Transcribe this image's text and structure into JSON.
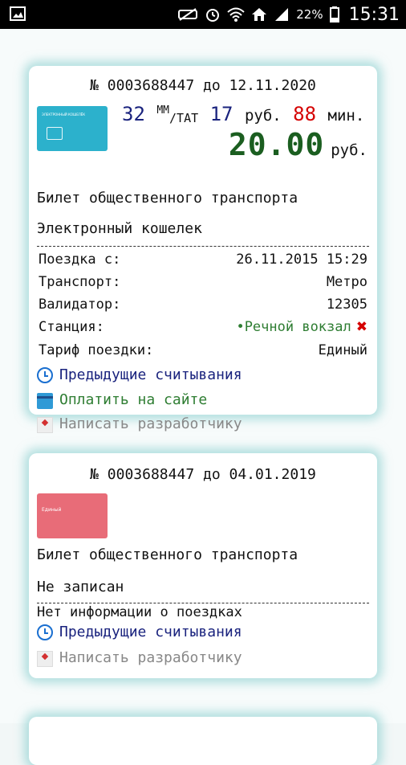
{
  "status_bar": {
    "battery_percent": "22%",
    "time": "15:31",
    "icons": [
      "gallery-icon",
      "mute-icon",
      "alarm-icon",
      "wifi-icon",
      "home-icon",
      "signal-icon",
      "battery-icon"
    ]
  },
  "cards": [
    {
      "ticket_number": "№ 0003688447 до 12.11.2020",
      "card_image_text": "ЭЛЕКТРОННЫЙ\nКОШЕЛЁК",
      "trips": "32",
      "trips_unit_sup": "ММ",
      "trips_unit_sub": "/ТАТ",
      "rubles": "17",
      "rubles_label": "руб.",
      "minutes": "88",
      "minutes_label": "мин.",
      "balance": "20.00",
      "balance_unit": "руб.",
      "ticket_type": "Билет общественного транспорта",
      "ticket_subtype": "Электронный кошелек",
      "details": [
        {
          "label": "Поездка с:",
          "value": "26.11.2015 15:29"
        },
        {
          "label": "Транспорт:",
          "value": "Метро"
        },
        {
          "label": "Валидатор:",
          "value": "12305"
        },
        {
          "label": "Станция:",
          "value": "•Речной вокзал"
        },
        {
          "label": "Тариф поездки:",
          "value": "Единый"
        }
      ],
      "links": {
        "history": "Предыдущие считывания",
        "pay": "Оплатить на сайте",
        "write": "Написать разработчику"
      }
    },
    {
      "ticket_number": "№ 0003688447 до 04.01.2019",
      "card_image_text": "Единый",
      "ticket_type": "Билет общественного транспорта",
      "ticket_subtype": "Не записан",
      "no_info": "Нет информации о поездках",
      "links": {
        "history": "Предыдущие считывания",
        "write": "Написать разработчику"
      }
    }
  ],
  "colors": {
    "accent_blue": "#1a237e",
    "accent_red": "#d50000",
    "balance_green": "#1b5e20",
    "card_blue": "#2cb1cc",
    "card_red": "#e86c78"
  }
}
